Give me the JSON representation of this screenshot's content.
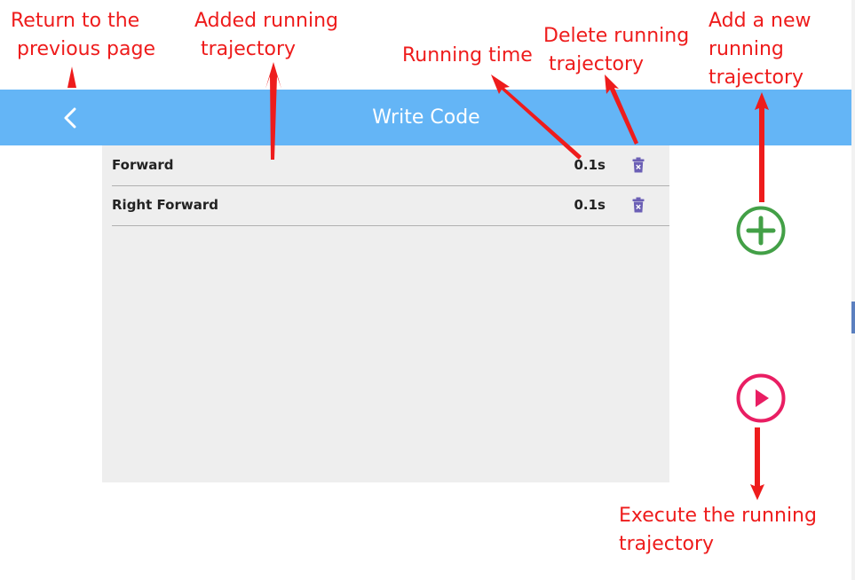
{
  "app_bar": {
    "title": "Write Code",
    "back_icon": "chevron-left-icon"
  },
  "trajectories": [
    {
      "name": "Forward",
      "time": "0.1s",
      "delete_icon": "trash-icon"
    },
    {
      "name": "Right Forward",
      "time": "0.1s",
      "delete_icon": "trash-icon"
    }
  ],
  "actions": {
    "add_icon": "plus-circle-icon",
    "execute_icon": "play-circle-icon"
  },
  "annotations": {
    "back": [
      "Return to the",
      "previous page"
    ],
    "added": [
      "Added running",
      "trajectory"
    ],
    "time": [
      "Running time"
    ],
    "delete": [
      "Delete running",
      "trajectory"
    ],
    "add_new": [
      "Add a new",
      "running",
      "trajectory"
    ],
    "execute": [
      "Execute the running",
      "trajectory"
    ]
  },
  "colors": {
    "app_bar": "#64b5f6",
    "panel": "#eeeeee",
    "add_green": "#43a047",
    "play_pink": "#e91e63",
    "trash_purple": "#6b5fb5",
    "annotation_red": "#ee1c1c"
  }
}
